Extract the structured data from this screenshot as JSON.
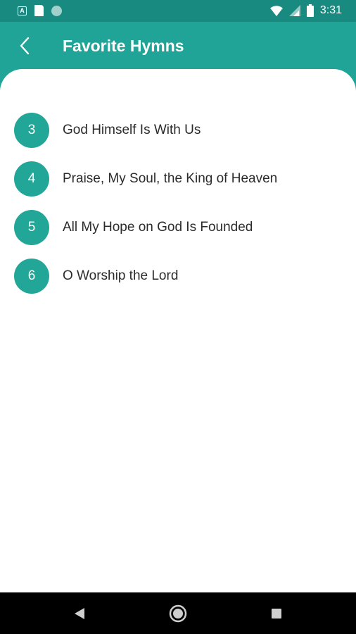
{
  "status_bar": {
    "time": "3:31",
    "icons": [
      "notification-a-icon",
      "sd-card-icon",
      "circle-icon",
      "wifi-icon",
      "signal-icon",
      "battery-icon"
    ]
  },
  "app_bar": {
    "title": "Favorite Hymns",
    "back_icon": "chevron-left-icon"
  },
  "hymns": [
    {
      "number": "3",
      "title": "God Himself Is With Us"
    },
    {
      "number": "4",
      "title": "Praise, My Soul, the King of Heaven"
    },
    {
      "number": "5",
      "title": "All My Hope on God Is Founded"
    },
    {
      "number": "6",
      "title": "O Worship the Lord"
    }
  ],
  "nav_bar": {
    "buttons": [
      "back-triangle-icon",
      "home-circle-icon",
      "recents-square-icon"
    ]
  },
  "colors": {
    "primary": "#1fa497",
    "status_bar": "#188a7f",
    "badge": "#21a697",
    "text": "#2b2b2b"
  }
}
